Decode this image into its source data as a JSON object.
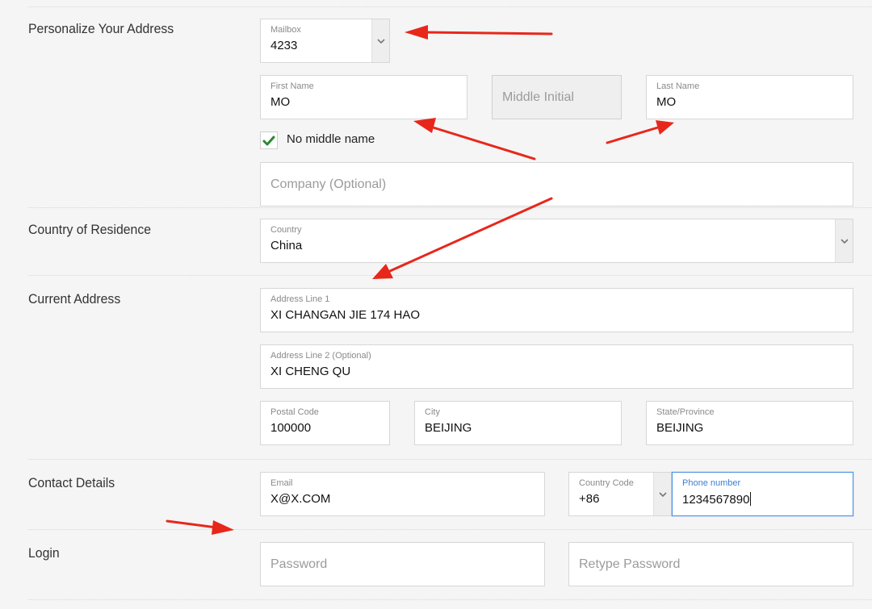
{
  "colors": {
    "arrow": "#e8271b",
    "focus": "#4a90e2",
    "check": "#2a8a2f"
  },
  "sections": {
    "personalize": "Personalize Your Address",
    "country": "Country of Residence",
    "address": "Current Address",
    "contact": "Contact Details",
    "login": "Login"
  },
  "mailbox": {
    "label": "Mailbox",
    "value": "4233"
  },
  "first_name": {
    "label": "First Name",
    "value": "MO"
  },
  "middle_initial": {
    "placeholder": "Middle Initial"
  },
  "last_name": {
    "label": "Last Name",
    "value": "MO"
  },
  "no_middle_name": {
    "label": "No middle name",
    "checked": true
  },
  "company": {
    "placeholder": "Company (Optional)"
  },
  "country": {
    "label": "Country",
    "value": "China"
  },
  "address1": {
    "label": "Address Line 1",
    "value": "XI CHANGAN JIE 174 HAO"
  },
  "address2": {
    "label": "Address Line 2 (Optional)",
    "value": "XI CHENG QU"
  },
  "postal": {
    "label": "Postal Code",
    "value": "100000"
  },
  "city": {
    "label": "City",
    "value": "BEIJING"
  },
  "state": {
    "label": "State/Province",
    "value": "BEIJING"
  },
  "email": {
    "label": "Email",
    "value": "X@X.COM"
  },
  "country_code": {
    "label": "Country Code",
    "value": "+86"
  },
  "phone": {
    "label": "Phone number",
    "value": "1234567890"
  },
  "password": {
    "placeholder": "Password"
  },
  "retype_password": {
    "placeholder": "Retype Password"
  },
  "icons": {
    "chevron": "chevron-down-icon",
    "check": "checkmark-icon",
    "arrow": "annotation-arrow"
  }
}
